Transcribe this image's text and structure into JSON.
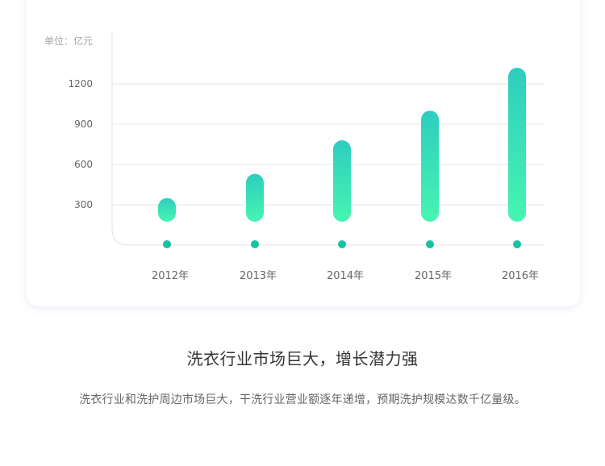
{
  "chart_data": {
    "type": "bar",
    "unit_label": "单位：亿元",
    "categories": [
      "2012年",
      "2013年",
      "2014年",
      "2015年",
      "2016年"
    ],
    "values": [
      350,
      530,
      780,
      1000,
      1320
    ],
    "yticks": [
      300,
      600,
      900,
      1200
    ],
    "ylim": [
      0,
      1450
    ],
    "grid": true,
    "colors": {
      "bar_top": "#2ecdbf",
      "bar_bottom": "#46f5b1",
      "dot": "#14c4a0",
      "grid": "#e6e6e6",
      "tick_text": "#666666"
    }
  },
  "headline": "洗衣行业市场巨大，增长潜力强",
  "description": "洗衣行业和洗护周边市场巨大，干洗行业营业额逐年递增，预期洗护规模达数千亿量级。"
}
